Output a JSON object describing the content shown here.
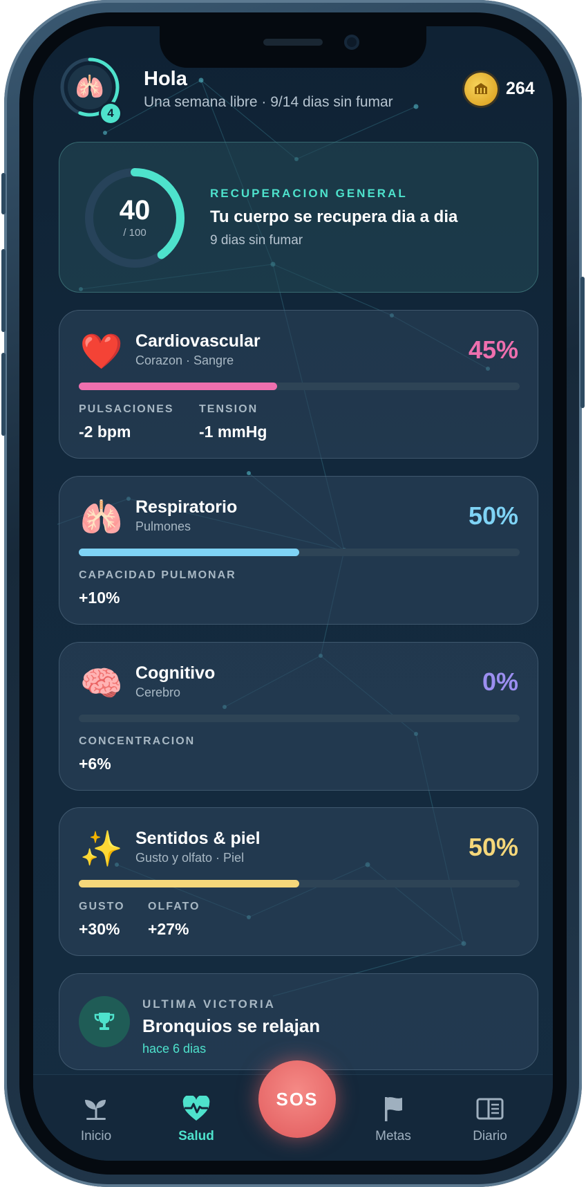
{
  "header": {
    "greeting": "Hola",
    "subtitle": "Una semana libre · 9/14 dias sin fumar",
    "level": "4",
    "coins": "264",
    "avatar_icon": "lungs-icon",
    "coin_icon": "coin-icon"
  },
  "overview": {
    "score": "40",
    "max": "/ 100",
    "score_fraction": 0.4,
    "label": "RECUPERACION GENERAL",
    "title": "Tu cuerpo se recupera dia a dia",
    "subtitle": "9 dias sin fumar",
    "accent": "#4ee2cc"
  },
  "systems": [
    {
      "icon": "❤️",
      "title": "Cardiovascular",
      "subtitle": "Corazon · Sangre",
      "percent": "45%",
      "progress": 0.45,
      "color": "#ee6fae",
      "metrics": [
        {
          "label": "PULSACIONES",
          "value": "-2 bpm"
        },
        {
          "label": "TENSION",
          "value": "-1 mmHg"
        }
      ]
    },
    {
      "icon": "🫁",
      "title": "Respiratorio",
      "subtitle": "Pulmones",
      "percent": "50%",
      "progress": 0.5,
      "color": "#7fd3f5",
      "metrics": [
        {
          "label": "CAPACIDAD PULMONAR",
          "value": "+10%"
        }
      ]
    },
    {
      "icon": "🧠",
      "title": "Cognitivo",
      "subtitle": "Cerebro",
      "percent": "0%",
      "progress": 0,
      "color": "#9b8ef0",
      "metrics": [
        {
          "label": "CONCENTRACION",
          "value": "+6%"
        }
      ]
    },
    {
      "icon": "✨",
      "title": "Sentidos & piel",
      "subtitle": "Gusto y olfato · Piel",
      "percent": "50%",
      "progress": 0.5,
      "color": "#f5d77a",
      "metrics": [
        {
          "label": "GUSTO",
          "value": "+30%"
        },
        {
          "label": "OLFATO",
          "value": "+27%"
        }
      ]
    }
  ],
  "victory": {
    "label": "ULTIMA VICTORIA",
    "title": "Bronquios se relajan",
    "time": "hace 6 dias",
    "icon": "trophy-icon"
  },
  "nav": {
    "items": [
      {
        "label": "Inicio",
        "icon": "sprout-icon"
      },
      {
        "label": "Salud",
        "icon": "heart-pulse-icon"
      },
      {
        "label": "Metas",
        "icon": "flag-icon"
      },
      {
        "label": "Diario",
        "icon": "journal-icon"
      }
    ],
    "active": "Salud",
    "sos_label": "SOS"
  }
}
